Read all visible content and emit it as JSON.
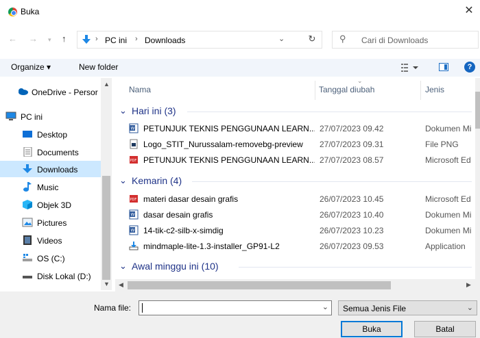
{
  "window": {
    "title": "Buka"
  },
  "address": {
    "crumbs": [
      "PC ini",
      "Downloads"
    ]
  },
  "search": {
    "placeholder": "Cari di Downloads"
  },
  "toolbar": {
    "organize": "Organize ▾",
    "new_folder": "New folder"
  },
  "nav": {
    "items": [
      {
        "label": "OneDrive - Persor",
        "icon": "cloud-icon"
      },
      {
        "label": "PC ini",
        "icon": "computer-icon"
      },
      {
        "label": "Desktop",
        "icon": "desktop-icon"
      },
      {
        "label": "Documents",
        "icon": "document-icon"
      },
      {
        "label": "Downloads",
        "icon": "download-icon",
        "selected": true
      },
      {
        "label": "Music",
        "icon": "music-icon"
      },
      {
        "label": "Objek 3D",
        "icon": "cube-icon"
      },
      {
        "label": "Pictures",
        "icon": "pictures-icon"
      },
      {
        "label": "Videos",
        "icon": "video-icon"
      },
      {
        "label": "OS (C:)",
        "icon": "drive-icon"
      },
      {
        "label": "Disk Lokal (D:)",
        "icon": "disk-icon"
      }
    ]
  },
  "columns": {
    "name": "Nama",
    "date": "Tanggal diubah",
    "type": "Jenis"
  },
  "groups": [
    {
      "label": "Hari ini (3)",
      "files": [
        {
          "name": "PETUNJUK TEKNIS PENGGUNAAN LEARN...",
          "date": "27/07/2023 09.42",
          "type": "Dokumen Mi",
          "icon": "word-icon"
        },
        {
          "name": "Logo_STIT_Nurussalam-removebg-preview",
          "date": "27/07/2023 09.31",
          "type": "File PNG",
          "icon": "image-icon"
        },
        {
          "name": "PETUNJUK TEKNIS PENGGUNAAN LEARN...",
          "date": "27/07/2023 08.57",
          "type": "Microsoft Ed",
          "icon": "pdf-icon"
        }
      ]
    },
    {
      "label": "Kemarin (4)",
      "files": [
        {
          "name": "materi dasar desain grafis",
          "date": "26/07/2023 10.45",
          "type": "Microsoft Ed",
          "icon": "pdf-icon"
        },
        {
          "name": "dasar desain grafis",
          "date": "26/07/2023 10.40",
          "type": "Dokumen Mi",
          "icon": "word-icon"
        },
        {
          "name": "14-tik-c2-silb-x-simdig",
          "date": "26/07/2023 10.23",
          "type": "Dokumen Mi",
          "icon": "word-icon"
        },
        {
          "name": "mindmaple-lite-1.3-installer_GP91-L2",
          "date": "26/07/2023 09.53",
          "type": "Application",
          "icon": "installer-icon"
        }
      ]
    },
    {
      "label": "Awal minggu ini (10)",
      "files": []
    }
  ],
  "footer": {
    "filename_label": "Nama file:",
    "filename_value": "",
    "filter": "Semua Jenis File",
    "open": "Buka",
    "cancel": "Batal"
  }
}
